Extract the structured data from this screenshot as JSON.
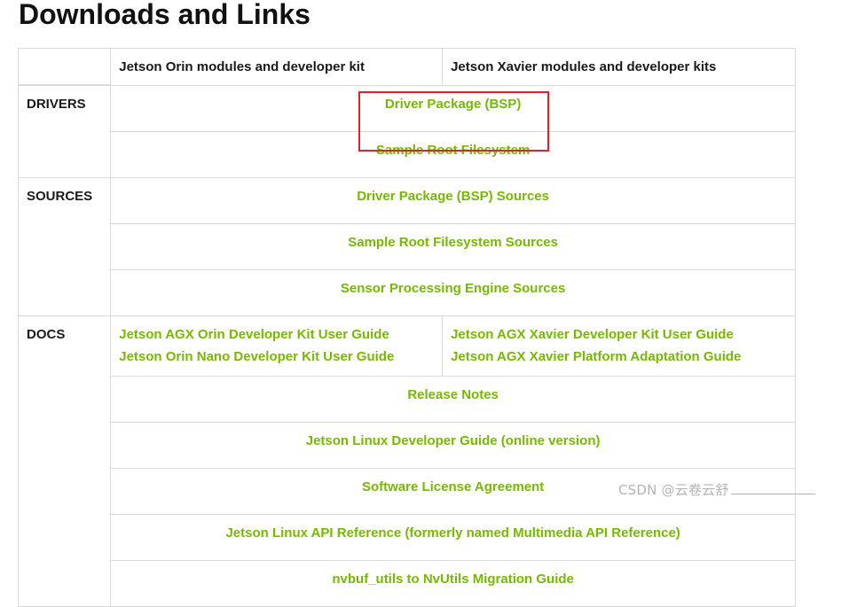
{
  "page": {
    "title": "Downloads and Links"
  },
  "table": {
    "header": {
      "orin": "Jetson Orin modules and developer kit",
      "xavier": "Jetson Xavier modules and developer kits"
    },
    "drivers": {
      "label": "DRIVERS",
      "links": [
        "Driver Package (BSP)",
        "Sample Root Filesystem"
      ]
    },
    "sources": {
      "label": "SOURCES",
      "links": [
        "Driver Package (BSP) Sources",
        "Sample Root Filesystem Sources",
        "Sensor Processing Engine Sources"
      ]
    },
    "docs": {
      "label": "DOCS",
      "orin_links": [
        "Jetson AGX Orin Developer Kit User Guide",
        "Jetson Orin Nano Developer Kit User Guide"
      ],
      "xavier_links": [
        "Jetson AGX Xavier Developer Kit User Guide",
        "Jetson AGX Xavier Platform Adaptation Guide"
      ],
      "links": [
        "Release Notes",
        "Jetson Linux Developer Guide (online version)",
        "Software License Agreement",
        "Jetson Linux API Reference (formerly named Multimedia API Reference)",
        "nvbuf_utils to NvUtils Migration Guide"
      ]
    }
  },
  "watermark": {
    "text": "CSDN @云卷云舒"
  },
  "colors": {
    "link": "#76b900",
    "highlight": "#e0202a",
    "border": "#d9d9d9"
  }
}
